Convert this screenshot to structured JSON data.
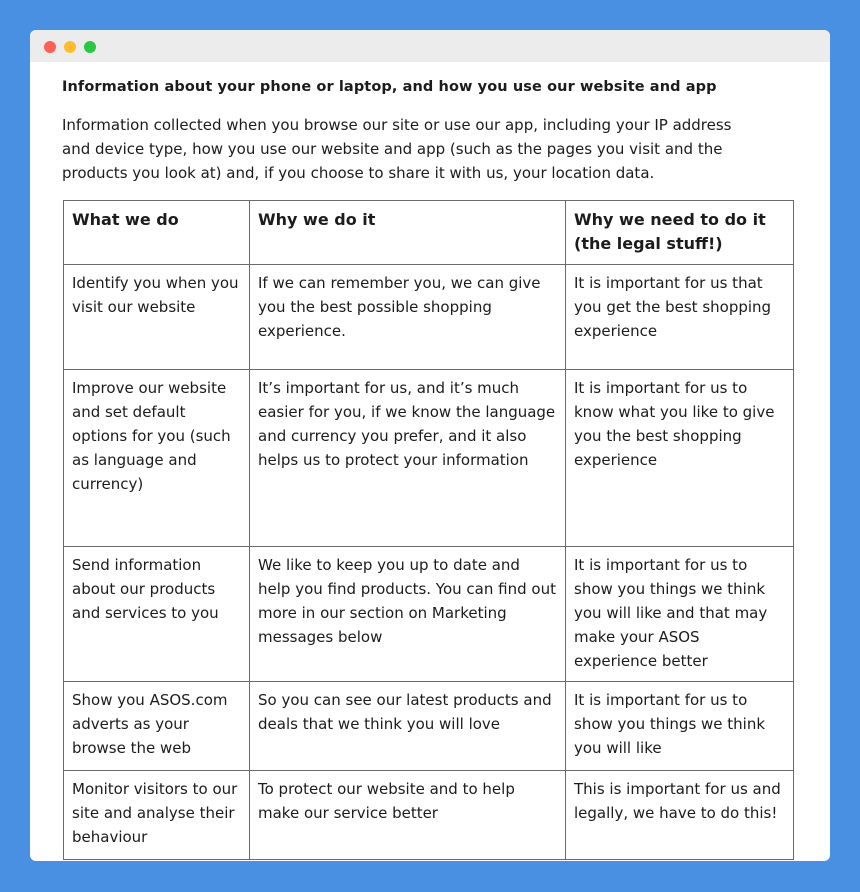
{
  "window": {
    "controls": [
      "close",
      "minimize",
      "maximize"
    ]
  },
  "section": {
    "heading": "Information about your phone or laptop, and how you use our website and app",
    "intro": "Information collected when you browse our site or use our app, including your IP address and device type, how you use our website and app (such as the pages you visit and the products you look at) and, if you choose to share it with us, your location data."
  },
  "table": {
    "headers": [
      "What we do",
      "Why we do it",
      "Why we need to do it (the legal stuff!)"
    ],
    "rows": [
      [
        "Identify you when you visit our website",
        "If we can remember you, we can give you the best possible shopping experience.",
        "It is important for us that you get the best shopping experience"
      ],
      [
        "Improve our website and set default options for you (such as language and currency)",
        "It’s important for us, and it’s much easier for you, if we know the language and currency you prefer, and it also helps us to protect your information",
        "It is important for us to know what you like to give you the best shopping experience"
      ],
      [
        "Send information about our products and services to you",
        "We like to keep you up to date and help you find products. You can find out more in our section on Marketing messages below",
        "It is important for us to show you things we think you will like and that may make your ASOS experience better"
      ],
      [
        "Show you ASOS.com adverts as your browse the web",
        "So you can see our latest products and deals that we think you will love",
        "It is important for us to show you things we think you will like"
      ],
      [
        "Monitor visitors to our site and analyse their behaviour",
        "To protect our website and to help make our service better",
        "This is important for us and legally, we have to do this!"
      ]
    ]
  }
}
